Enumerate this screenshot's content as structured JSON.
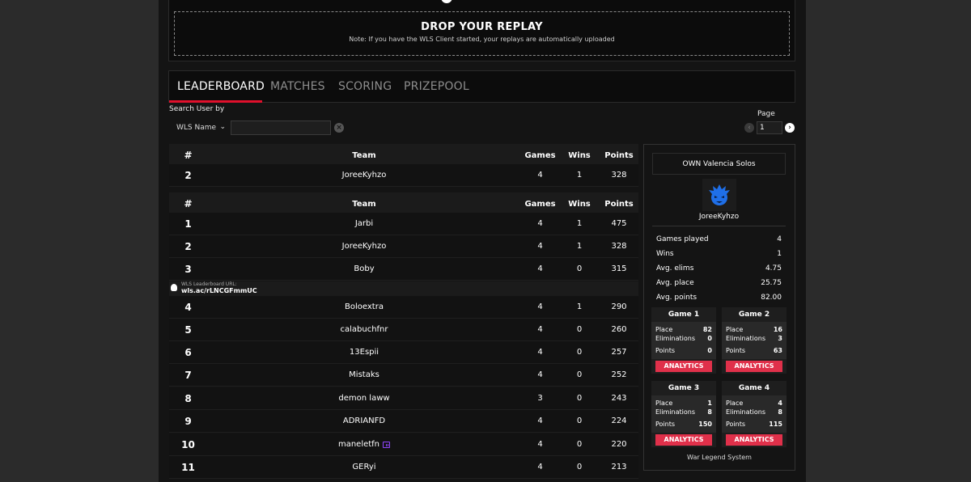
{
  "drop": {
    "title": "DROP YOUR REPLAY",
    "note": "Note: If you have the WLS Client started, your replays are automatically uploaded"
  },
  "tabs": [
    {
      "label": "LEADERBOARD",
      "active": true
    },
    {
      "label": "MATCHES",
      "active": false
    },
    {
      "label": "SCORING",
      "active": false
    },
    {
      "label": "PRIZEPOOL",
      "active": false
    }
  ],
  "search": {
    "label": "Search User by",
    "select_value": "WLS Name",
    "input_value": ""
  },
  "pagination": {
    "label": "Page",
    "value": "1"
  },
  "table_headers": {
    "rank": "#",
    "team": "Team",
    "games": "Games",
    "wins": "Wins",
    "points": "Points"
  },
  "my_row": {
    "rank": "2",
    "team": "JoreeKyhzo",
    "games": "4",
    "wins": "1",
    "points": "328"
  },
  "rows": [
    {
      "rank": "1",
      "team": "Jarbi",
      "games": "4",
      "wins": "1",
      "points": "475"
    },
    {
      "rank": "2",
      "team": "JoreeKyhzo",
      "games": "4",
      "wins": "1",
      "points": "328"
    },
    {
      "rank": "3",
      "team": "Boby",
      "games": "4",
      "wins": "0",
      "points": "315"
    },
    {
      "rank": "4",
      "team": "Boloextra",
      "games": "4",
      "wins": "1",
      "points": "290"
    },
    {
      "rank": "5",
      "team": "calabuchfnr",
      "games": "4",
      "wins": "0",
      "points": "260"
    },
    {
      "rank": "6",
      "team": "13Espii",
      "games": "4",
      "wins": "0",
      "points": "257"
    },
    {
      "rank": "7",
      "team": "Mistaks",
      "games": "4",
      "wins": "0",
      "points": "252"
    },
    {
      "rank": "8",
      "team": "demon laww",
      "games": "3",
      "wins": "0",
      "points": "243"
    },
    {
      "rank": "9",
      "team": "ADRIANFD",
      "games": "4",
      "wins": "0",
      "points": "224"
    },
    {
      "rank": "10",
      "team": "maneletfn",
      "games": "4",
      "wins": "0",
      "points": "220"
    },
    {
      "rank": "11",
      "team": "GERyi",
      "games": "4",
      "wins": "0",
      "points": "213"
    }
  ],
  "url_banner": {
    "label": "WLS Leaderboard URL:",
    "value": "wls.ac/rLNCGFmmUC"
  },
  "side": {
    "tournament": "OWN Valencia Solos",
    "player": "JoreeKyhzo",
    "stats": [
      {
        "label": "Games played",
        "value": "4"
      },
      {
        "label": "Wins",
        "value": "1"
      },
      {
        "label": "Avg. elims",
        "value": "4.75"
      },
      {
        "label": "Avg. place",
        "value": "25.75"
      },
      {
        "label": "Avg. points",
        "value": "82.00"
      }
    ],
    "games": [
      {
        "title": "Game 1",
        "place": "82",
        "elims": "0",
        "points": "0"
      },
      {
        "title": "Game 2",
        "place": "16",
        "elims": "3",
        "points": "63"
      },
      {
        "title": "Game 3",
        "place": "1",
        "elims": "8",
        "points": "150"
      },
      {
        "title": "Game 4",
        "place": "4",
        "elims": "8",
        "points": "115"
      }
    ],
    "game_labels": {
      "place": "Place",
      "elims": "Eliminations",
      "points": "Points"
    },
    "analytics_label": "ANALYTICS",
    "footer": "War Legend System"
  },
  "colors": {
    "accent": "#e0102c",
    "analytics": "#e0304a",
    "avatar": "#1f6fe8",
    "twitch": "#9146ff"
  }
}
